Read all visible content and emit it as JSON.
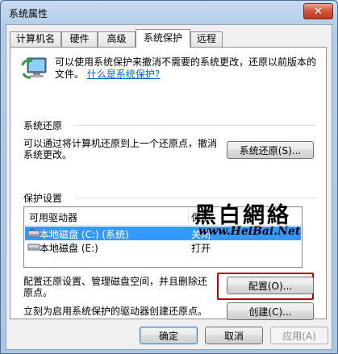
{
  "window": {
    "title": "系统属性",
    "close": "✕"
  },
  "tabs": [
    "计算机名",
    "硬件",
    "高级",
    "系统保护",
    "远程"
  ],
  "intro": {
    "text": "可以使用系统保护来撤消不需要的系统更改，还原以前版本的文件。",
    "link": "什么是系统保护?"
  },
  "restore": {
    "group_label": "系统还原",
    "description": "可以通过将计算机还原到上一个还原点，撤消系统更改。",
    "button": "系统还原(S)..."
  },
  "protection": {
    "group_label": "保护设置",
    "columns": [
      "可用驱动器",
      "保护"
    ],
    "drives": [
      {
        "name": "本地磁盘 (C:) (系统)",
        "status": "关闭",
        "selected": true
      },
      {
        "name": "本地磁盘 (E:)",
        "status": "打开",
        "selected": false
      }
    ],
    "configure_text": "配置还原设置、管理磁盘空间，并且删除还原点。",
    "configure_button": "配置(O)...",
    "create_text": "立刻为启用系统保护的驱动器创建还原点。",
    "create_button": "创建(C)..."
  },
  "footer": {
    "ok": "确定",
    "cancel": "取消",
    "apply": "应用(A)"
  },
  "watermark": {
    "big": "黑白網絡",
    "url": "www.HeiBai.Net"
  },
  "colors": {
    "selection": "#3399ff",
    "link": "#0066cc",
    "highlight_box": "#c00000"
  }
}
